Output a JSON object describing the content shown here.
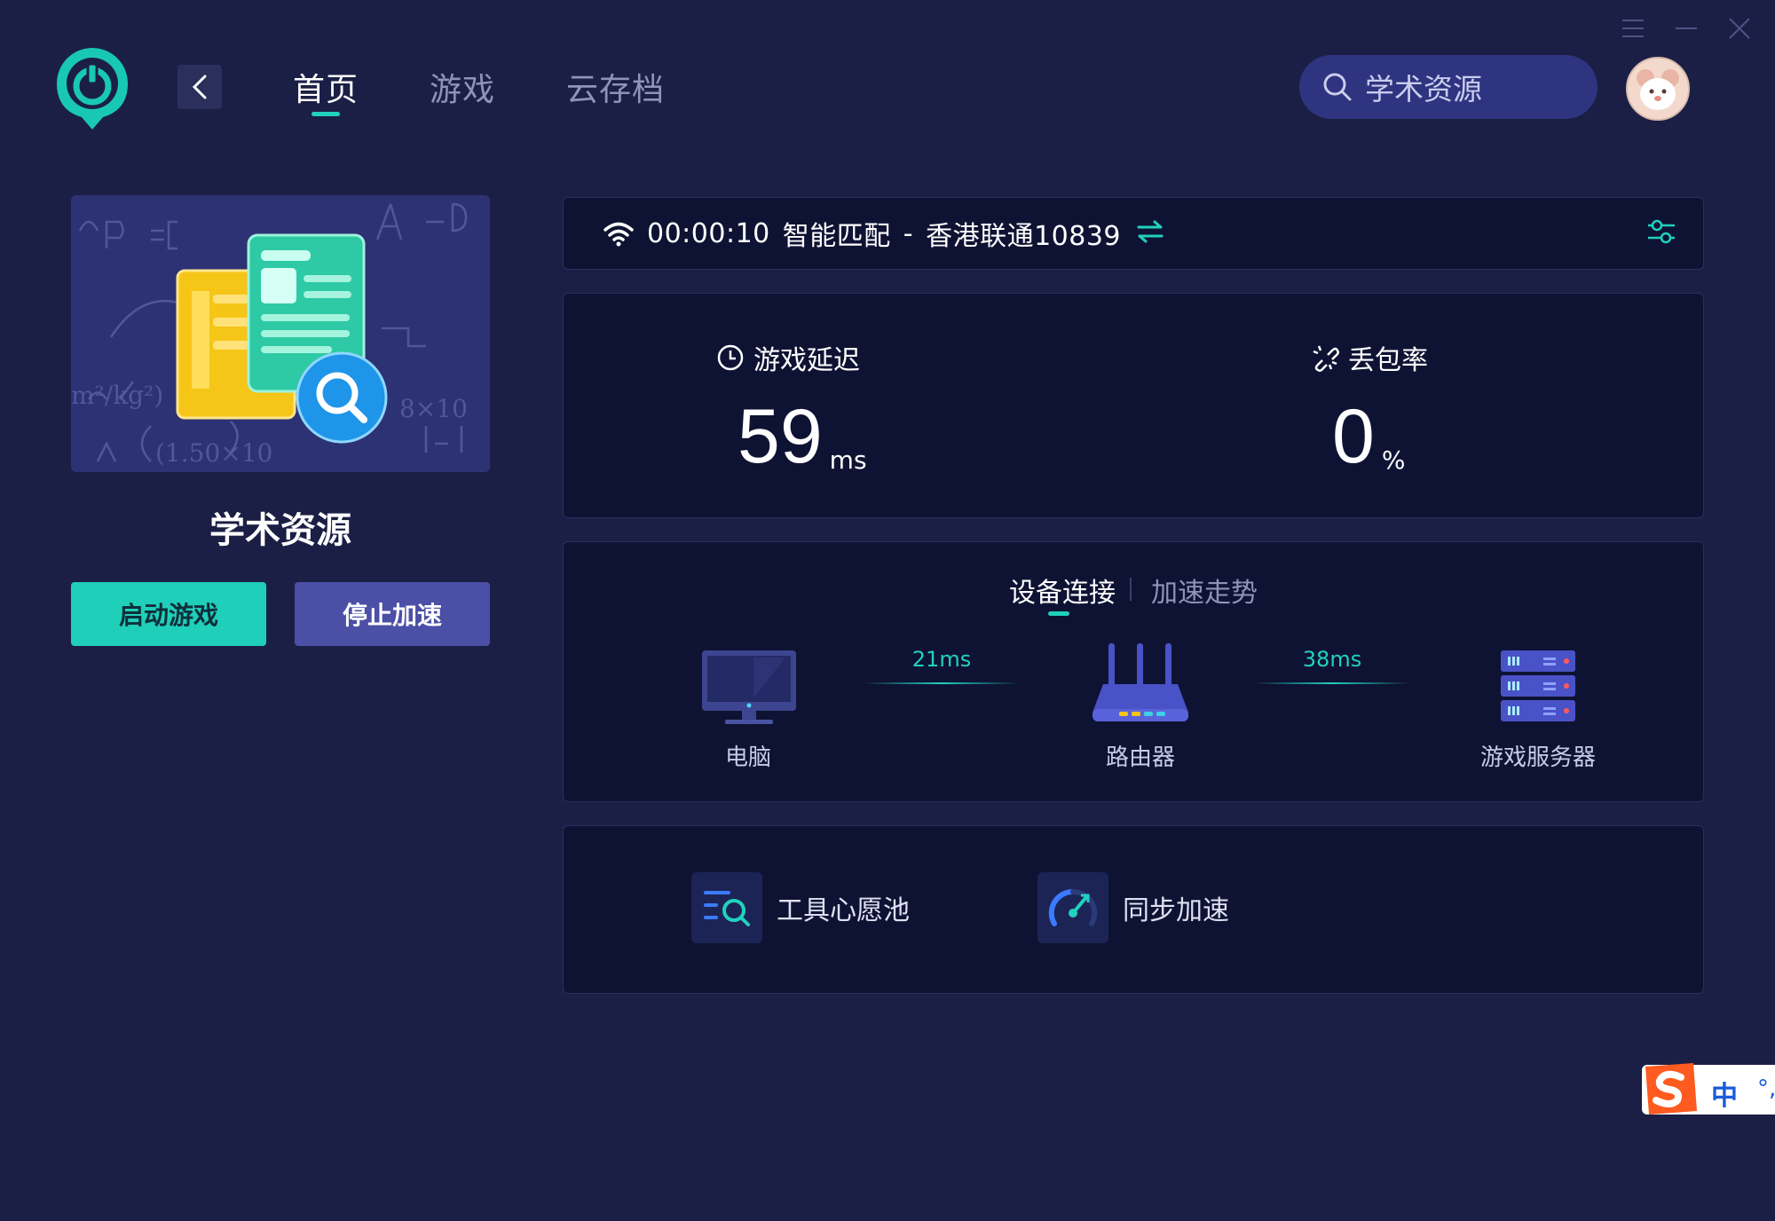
{
  "window": {
    "menu_icon": "menu-icon",
    "minimize_icon": "minimize-icon",
    "close_icon": "close-icon"
  },
  "header": {
    "nav": [
      {
        "label": "首页",
        "active": true
      },
      {
        "label": "游戏"
      },
      {
        "label": "云存档"
      }
    ],
    "search": {
      "value": "学术资源",
      "icon": "search-icon"
    }
  },
  "game": {
    "title": "学术资源",
    "start_label": "启动游戏",
    "stop_label": "停止加速"
  },
  "status": {
    "timer": "00:00:10",
    "mode": "智能匹配",
    "separator": "-",
    "server": "香港联通10839"
  },
  "metrics": {
    "latency": {
      "label": "游戏延迟",
      "value": "59",
      "unit": "ms"
    },
    "packet_loss": {
      "label": "丢包率",
      "value": "0",
      "unit": "%"
    }
  },
  "connection": {
    "tabs": [
      {
        "label": "设备连接",
        "active": true
      },
      {
        "label": "加速走势"
      }
    ],
    "nodes": [
      {
        "label": "电脑"
      },
      {
        "label": "路由器"
      },
      {
        "label": "游戏服务器"
      }
    ],
    "links": [
      {
        "latency": "21ms"
      },
      {
        "latency": "38ms"
      }
    ]
  },
  "tools": [
    {
      "label": "工具心愿池"
    },
    {
      "label": "同步加速"
    }
  ],
  "ime": {
    "label": "中"
  },
  "colors": {
    "accent": "#21d1bd",
    "background": "#1b1f45",
    "panel": "#0f1333",
    "stop_button": "#4b4fa6"
  }
}
